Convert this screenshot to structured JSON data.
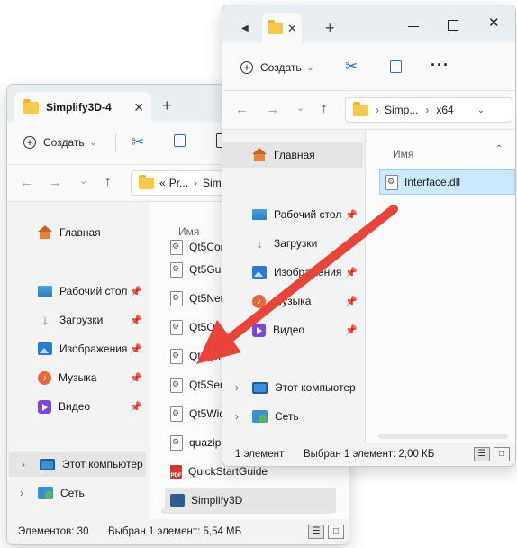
{
  "back_window": {
    "tab_title": "Simplify3D-4",
    "create_label": "Создать",
    "address": {
      "prefix": "«",
      "crumb1": "Pr...",
      "separator": "›",
      "crumb2": "Sim"
    },
    "column_name": "Имя",
    "sidebar": {
      "home": "Главная",
      "desktop": "Рабочий стол",
      "downloads": "Загрузки",
      "images": "Изображения",
      "music": "Музыка",
      "video": "Видео",
      "this_pc": "Этот компьютер",
      "network": "Сеть"
    },
    "files": [
      "Qt5Core",
      "Qt5Gui.",
      "Qt5Netw",
      "Qt5Ope",
      "Qt5Qml",
      "Qt5Seria",
      "Qt5Wid",
      "quazip.",
      "QuickStartGuide",
      "Simplify3D"
    ],
    "status": {
      "count": "Элементов: 30",
      "selected": "Выбран 1 элемент: 5,54 МБ"
    }
  },
  "front_window": {
    "create_label": "Создать",
    "address": {
      "crumb1": "Simp...",
      "separator": "›",
      "crumb2": "x64"
    },
    "column_name": "Имя",
    "sidebar": {
      "home": "Главная",
      "desktop": "Рабочий стол",
      "downloads": "Загрузки",
      "images": "Изображения",
      "music": "Музыка",
      "video": "Видео",
      "this_pc": "Этот компьютер",
      "network": "Сеть"
    },
    "files": [
      "Interface.dll"
    ],
    "status": {
      "count": "1 элемент",
      "selected": "Выбран 1 элемент: 2,00 КБ"
    }
  },
  "arrow": {
    "color": "#e8443a"
  },
  "colors": {
    "selection": "#cce8ff",
    "selected_gray": "#e5e5e5",
    "tabbar": "#e9eef3"
  }
}
